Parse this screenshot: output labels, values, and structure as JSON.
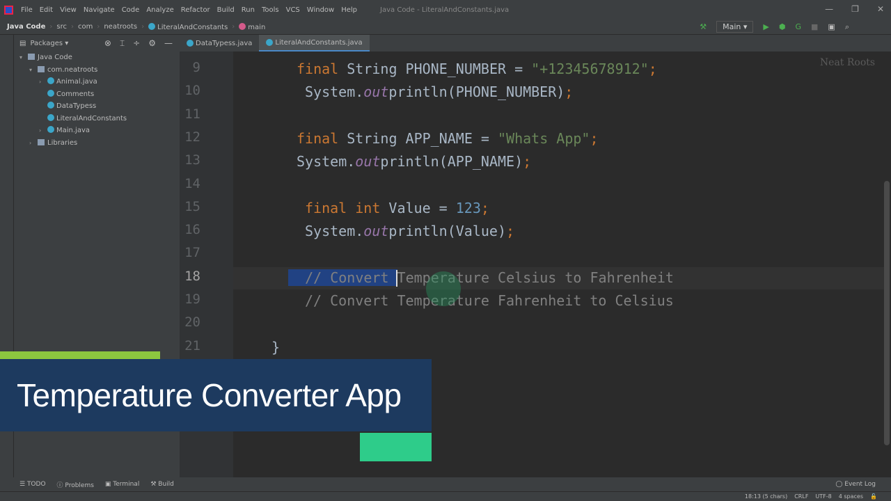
{
  "menu": [
    "File",
    "Edit",
    "View",
    "Navigate",
    "Code",
    "Analyze",
    "Refactor",
    "Build",
    "Run",
    "Tools",
    "VCS",
    "Window",
    "Help"
  ],
  "window_title": "Java Code - LiteralAndConstants.java",
  "breadcrumb": [
    "Java Code",
    "src",
    "com",
    "neatroots",
    "LiteralAndConstants",
    "main"
  ],
  "run_config": "Main",
  "sidebar": {
    "view": "Packages",
    "items": [
      {
        "label": "Java Code",
        "depth": 0,
        "fold": "▾"
      },
      {
        "label": "com.neatroots",
        "depth": 1,
        "fold": "▾"
      },
      {
        "label": "Animal.java",
        "depth": 2,
        "fold": "›"
      },
      {
        "label": "Comments",
        "depth": 2,
        "fold": ""
      },
      {
        "label": "DataTypess",
        "depth": 2,
        "fold": ""
      },
      {
        "label": "LiteralAndConstants",
        "depth": 2,
        "fold": ""
      },
      {
        "label": "Main.java",
        "depth": 2,
        "fold": "›"
      },
      {
        "label": "Libraries",
        "depth": 1,
        "fold": "›"
      }
    ]
  },
  "tabs": [
    {
      "label": "DataTypess.java",
      "active": false
    },
    {
      "label": "LiteralAndConstants.java",
      "active": true
    }
  ],
  "code_lines": [
    {
      "n": "9",
      "indent": 7,
      "tokens": [
        [
          "kw",
          "final "
        ],
        [
          "",
          "String PHONE_NUMBER = "
        ],
        [
          "str",
          "\"+12345678912\""
        ],
        [
          "kw",
          ";"
        ]
      ]
    },
    {
      "n": "10",
      "indent": 8,
      "tokens": [
        [
          "",
          "System."
        ],
        [
          "fld",
          "out"
        ],
        [
          "",
          "println(PHONE_NUMBER)"
        ],
        [
          "kw",
          ";"
        ]
      ]
    },
    {
      "n": "11",
      "indent": 0,
      "tokens": []
    },
    {
      "n": "12",
      "indent": 7,
      "tokens": [
        [
          "kw",
          "final "
        ],
        [
          "",
          "String APP_NAME = "
        ],
        [
          "str",
          "\"Whats App\""
        ],
        [
          "kw",
          ";"
        ]
      ]
    },
    {
      "n": "13",
      "indent": 7,
      "tokens": [
        [
          "",
          "System."
        ],
        [
          "fld",
          "out"
        ],
        [
          "",
          "println(APP_NAME)"
        ],
        [
          "kw",
          ";"
        ]
      ]
    },
    {
      "n": "14",
      "indent": 0,
      "tokens": []
    },
    {
      "n": "15",
      "indent": 8,
      "tokens": [
        [
          "kw",
          "final int "
        ],
        [
          "",
          "Value = "
        ],
        [
          "num",
          "123"
        ],
        [
          "kw",
          ";"
        ]
      ]
    },
    {
      "n": "16",
      "indent": 8,
      "tokens": [
        [
          "",
          "System."
        ],
        [
          "fld",
          "out"
        ],
        [
          "",
          "println(Value)"
        ],
        [
          "kw",
          ";"
        ]
      ]
    },
    {
      "n": "17",
      "indent": 0,
      "tokens": []
    },
    {
      "n": "18",
      "indent": 6,
      "tokens": [
        [
          "cm sel",
          "  // Convert "
        ],
        [
          "cm",
          "Temperature Celsius to Fahrenheit"
        ]
      ]
    },
    {
      "n": "19",
      "indent": 8,
      "tokens": [
        [
          "cm",
          "// Convert Temperature Fahrenheit to Celsius"
        ]
      ]
    },
    {
      "n": "20",
      "indent": 0,
      "tokens": []
    },
    {
      "n": "21",
      "indent": 4,
      "tokens": [
        [
          "",
          "}"
        ]
      ]
    }
  ],
  "banner": {
    "title": "Temperature Converter App"
  },
  "watermark": "Neat Roots",
  "bottom_tools": [
    "TODO",
    "Problems",
    "Terminal",
    "Build"
  ],
  "event_log": "Event Log",
  "status": [
    "18:13 (5 chars)",
    "CRLF",
    "UTF-8",
    "4 spaces"
  ],
  "colors": {
    "keyword": "#cc7832",
    "string": "#6a8759",
    "number": "#6897bb",
    "comment": "#808080",
    "banner": "#1d3a5f",
    "accent_green": "#2ecc8a"
  }
}
